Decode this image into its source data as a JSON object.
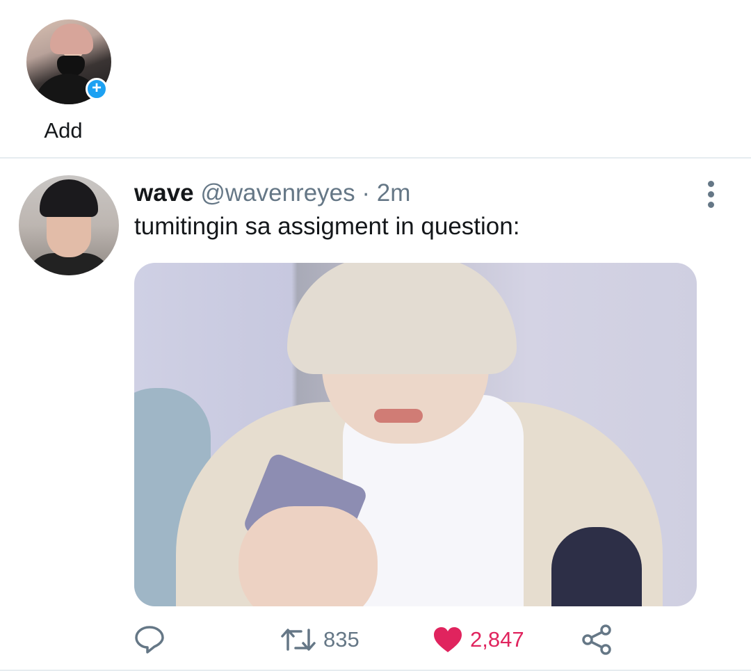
{
  "fleets": {
    "add_label": "Add"
  },
  "tweet": {
    "display_name": "wave",
    "handle": "@wavenreyes",
    "separator": "·",
    "time": "2m",
    "text": "tumitingin sa assigment in question:",
    "actions": {
      "reply_count": "",
      "retweet_count": "835",
      "like_count": "2,847"
    }
  },
  "colors": {
    "accent": "#1da1f2",
    "like": "#e0245e",
    "secondary_text": "#657786"
  }
}
